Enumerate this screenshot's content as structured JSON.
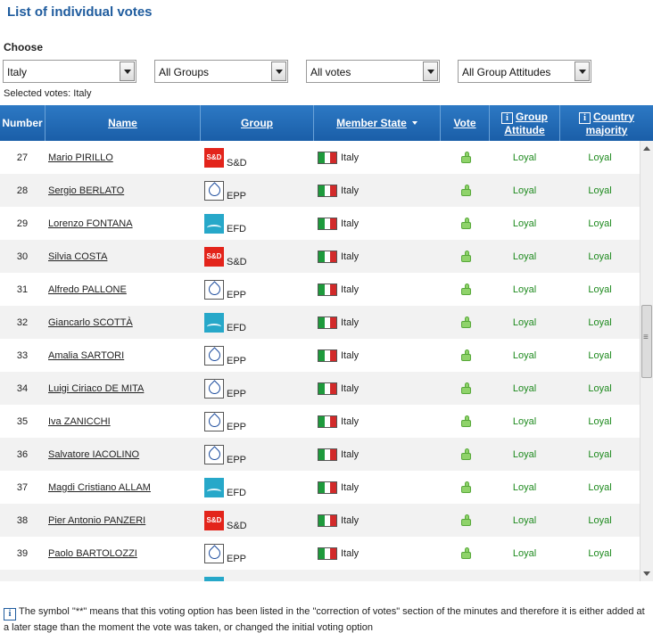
{
  "title": "List of individual votes",
  "filters": {
    "label": "Choose",
    "country": "Italy",
    "groups": "All Groups",
    "votes": "All votes",
    "attitudes": "All Group Attitudes",
    "selected_info": "Selected votes: Italy"
  },
  "table": {
    "columns": {
      "number": "Number",
      "name": "Name",
      "group": "Group",
      "state": "Member State",
      "vote": "Vote",
      "attitude": "Group Attitude",
      "majority": "Country majority"
    },
    "rows": [
      {
        "num": "27",
        "name": "Mario PIRILLO",
        "group": "S&D",
        "logo": "sd",
        "state": "Italy",
        "attitude": "Loyal",
        "majority": "Loyal"
      },
      {
        "num": "28",
        "name": "Sergio BERLATO",
        "group": "EPP",
        "logo": "epp",
        "state": "Italy",
        "attitude": "Loyal",
        "majority": "Loyal"
      },
      {
        "num": "29",
        "name": "Lorenzo FONTANA",
        "group": "EFD",
        "logo": "efd",
        "state": "Italy",
        "attitude": "Loyal",
        "majority": "Loyal"
      },
      {
        "num": "30",
        "name": "Silvia COSTA",
        "group": "S&D",
        "logo": "sd",
        "state": "Italy",
        "attitude": "Loyal",
        "majority": "Loyal"
      },
      {
        "num": "31",
        "name": "Alfredo PALLONE",
        "group": "EPP",
        "logo": "epp",
        "state": "Italy",
        "attitude": "Loyal",
        "majority": "Loyal"
      },
      {
        "num": "32",
        "name": "Giancarlo SCOTTÀ",
        "group": "EFD",
        "logo": "efd",
        "state": "Italy",
        "attitude": "Loyal",
        "majority": "Loyal"
      },
      {
        "num": "33",
        "name": "Amalia SARTORI",
        "group": "EPP",
        "logo": "epp",
        "state": "Italy",
        "attitude": "Loyal",
        "majority": "Loyal"
      },
      {
        "num": "34",
        "name": "Luigi Ciriaco DE MITA",
        "group": "EPP",
        "logo": "epp",
        "state": "Italy",
        "attitude": "Loyal",
        "majority": "Loyal"
      },
      {
        "num": "35",
        "name": "Iva ZANICCHI",
        "group": "EPP",
        "logo": "epp",
        "state": "Italy",
        "attitude": "Loyal",
        "majority": "Loyal"
      },
      {
        "num": "36",
        "name": "Salvatore IACOLINO",
        "group": "EPP",
        "logo": "epp",
        "state": "Italy",
        "attitude": "Loyal",
        "majority": "Loyal"
      },
      {
        "num": "37",
        "name": "Magdi Cristiano ALLAM",
        "group": "EFD",
        "logo": "efd",
        "state": "Italy",
        "attitude": "Loyal",
        "majority": "Loyal"
      },
      {
        "num": "38",
        "name": "Pier Antonio PANZERI",
        "group": "S&D",
        "logo": "sd",
        "state": "Italy",
        "attitude": "Loyal",
        "majority": "Loyal"
      },
      {
        "num": "39",
        "name": "Paolo BARTOLOZZI",
        "group": "EPP",
        "logo": "epp",
        "state": "Italy",
        "attitude": "Loyal",
        "majority": "Loyal"
      },
      {
        "num": "",
        "name": "",
        "group": "",
        "logo": "efd",
        "state": "",
        "attitude": "",
        "majority": ""
      }
    ]
  },
  "footnote": "The symbol \"**\" means that this voting option has been listed in the \"correction of votes\" section of the minutes and therefore it is either added at a later stage than the moment the vote was taken, or changed the initial voting option",
  "colors": {
    "header_blue": "#1a5ea8",
    "title_blue": "#1f5c9e",
    "loyal_green": "#1e8a1e",
    "sd_red": "#e3241b",
    "efd_teal": "#27a8c9"
  }
}
